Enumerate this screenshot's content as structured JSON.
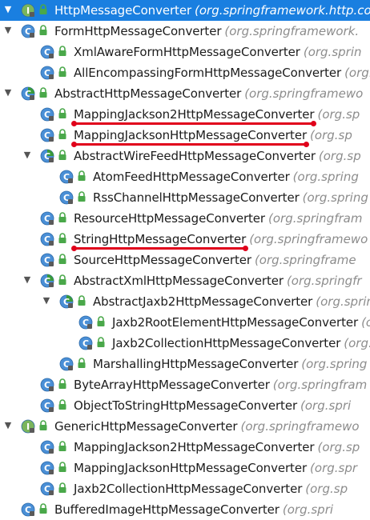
{
  "colors": {
    "selection": "#1a7fe0",
    "underline": "#e0001b",
    "package": "#8c8c8c"
  },
  "rows": [
    {
      "depth": 0,
      "expander": "down",
      "kind": "interface",
      "name": "HttpMessageConverter",
      "pkg": "(org.springframework.http.co",
      "selected": true,
      "underline": false
    },
    {
      "depth": 0,
      "expander": "down",
      "kind": "class",
      "name": "FormHttpMessageConverter",
      "pkg": "(org.springframework.",
      "selected": false,
      "underline": false
    },
    {
      "depth": 1,
      "expander": "none",
      "kind": "class",
      "name": "XmlAwareFormHttpMessageConverter",
      "pkg": "(org.sprin",
      "selected": false,
      "underline": false
    },
    {
      "depth": 1,
      "expander": "none",
      "kind": "class",
      "name": "AllEncompassingFormHttpMessageConverter",
      "pkg": "(org.sp",
      "selected": false,
      "underline": false
    },
    {
      "depth": 0,
      "expander": "down",
      "kind": "abstract",
      "name": "AbstractHttpMessageConverter",
      "pkg": "(org.springframewo",
      "selected": false,
      "underline": false
    },
    {
      "depth": 1,
      "expander": "none",
      "kind": "class",
      "name": "MappingJackson2HttpMessageConverter",
      "pkg": "(org.sp",
      "selected": false,
      "underline": true
    },
    {
      "depth": 1,
      "expander": "none",
      "kind": "class",
      "name": "MappingJacksonHttpMessageConverter",
      "pkg": "(org.sp",
      "selected": false,
      "underline": true
    },
    {
      "depth": 1,
      "expander": "down",
      "kind": "abstract",
      "name": "AbstractWireFeedHttpMessageConverter",
      "pkg": "(org.sp",
      "selected": false,
      "underline": false
    },
    {
      "depth": 2,
      "expander": "none",
      "kind": "class",
      "name": "AtomFeedHttpMessageConverter",
      "pkg": "(org.spring",
      "selected": false,
      "underline": false
    },
    {
      "depth": 2,
      "expander": "none",
      "kind": "class",
      "name": "RssChannelHttpMessageConverter",
      "pkg": "(org.spring",
      "selected": false,
      "underline": false
    },
    {
      "depth": 1,
      "expander": "none",
      "kind": "class",
      "name": "ResourceHttpMessageConverter",
      "pkg": "(org.springfram",
      "selected": false,
      "underline": false
    },
    {
      "depth": 1,
      "expander": "none",
      "kind": "class",
      "name": "StringHttpMessageConverter",
      "pkg": "(org.springframewo",
      "selected": false,
      "underline": true
    },
    {
      "depth": 1,
      "expander": "none",
      "kind": "class",
      "name": "SourceHttpMessageConverter",
      "pkg": "(org.springframe",
      "selected": false,
      "underline": false
    },
    {
      "depth": 1,
      "expander": "down",
      "kind": "abstract",
      "name": "AbstractXmlHttpMessageConverter",
      "pkg": "(org.springfr",
      "selected": false,
      "underline": false
    },
    {
      "depth": 2,
      "expander": "down",
      "kind": "abstract",
      "name": "AbstractJaxb2HttpMessageConverter",
      "pkg": "(org.sprin",
      "selected": false,
      "underline": false
    },
    {
      "depth": 3,
      "expander": "none",
      "kind": "class",
      "name": "Jaxb2RootElementHttpMessageConverter",
      "pkg": "(org",
      "selected": false,
      "underline": false
    },
    {
      "depth": 3,
      "expander": "none",
      "kind": "class",
      "name": "Jaxb2CollectionHttpMessageConverter",
      "pkg": "(org.s",
      "selected": false,
      "underline": false
    },
    {
      "depth": 2,
      "expander": "none",
      "kind": "class",
      "name": "MarshallingHttpMessageConverter",
      "pkg": "(org.spring",
      "selected": false,
      "underline": false
    },
    {
      "depth": 1,
      "expander": "none",
      "kind": "class",
      "name": "ByteArrayHttpMessageConverter",
      "pkg": "(org.springfram",
      "selected": false,
      "underline": false
    },
    {
      "depth": 1,
      "expander": "none",
      "kind": "class",
      "name": "ObjectToStringHttpMessageConverter",
      "pkg": "(org.spri",
      "selected": false,
      "underline": false
    },
    {
      "depth": 0,
      "expander": "down",
      "kind": "interface",
      "name": "GenericHttpMessageConverter",
      "pkg": "(org.springframewo",
      "selected": false,
      "underline": false
    },
    {
      "depth": 1,
      "expander": "none",
      "kind": "class",
      "name": "MappingJackson2HttpMessageConverter",
      "pkg": "(org.sp",
      "selected": false,
      "underline": false
    },
    {
      "depth": 1,
      "expander": "none",
      "kind": "class",
      "name": "MappingJacksonHttpMessageConverter",
      "pkg": "(org.spr",
      "selected": false,
      "underline": false
    },
    {
      "depth": 1,
      "expander": "none",
      "kind": "class",
      "name": "Jaxb2CollectionHttpMessageConverter",
      "pkg": "(org.sp",
      "selected": false,
      "underline": false
    },
    {
      "depth": 0,
      "expander": "none",
      "kind": "class",
      "name": "BufferedImageHttpMessageConverter",
      "pkg": "(org.spri",
      "selected": false,
      "underline": false
    }
  ]
}
